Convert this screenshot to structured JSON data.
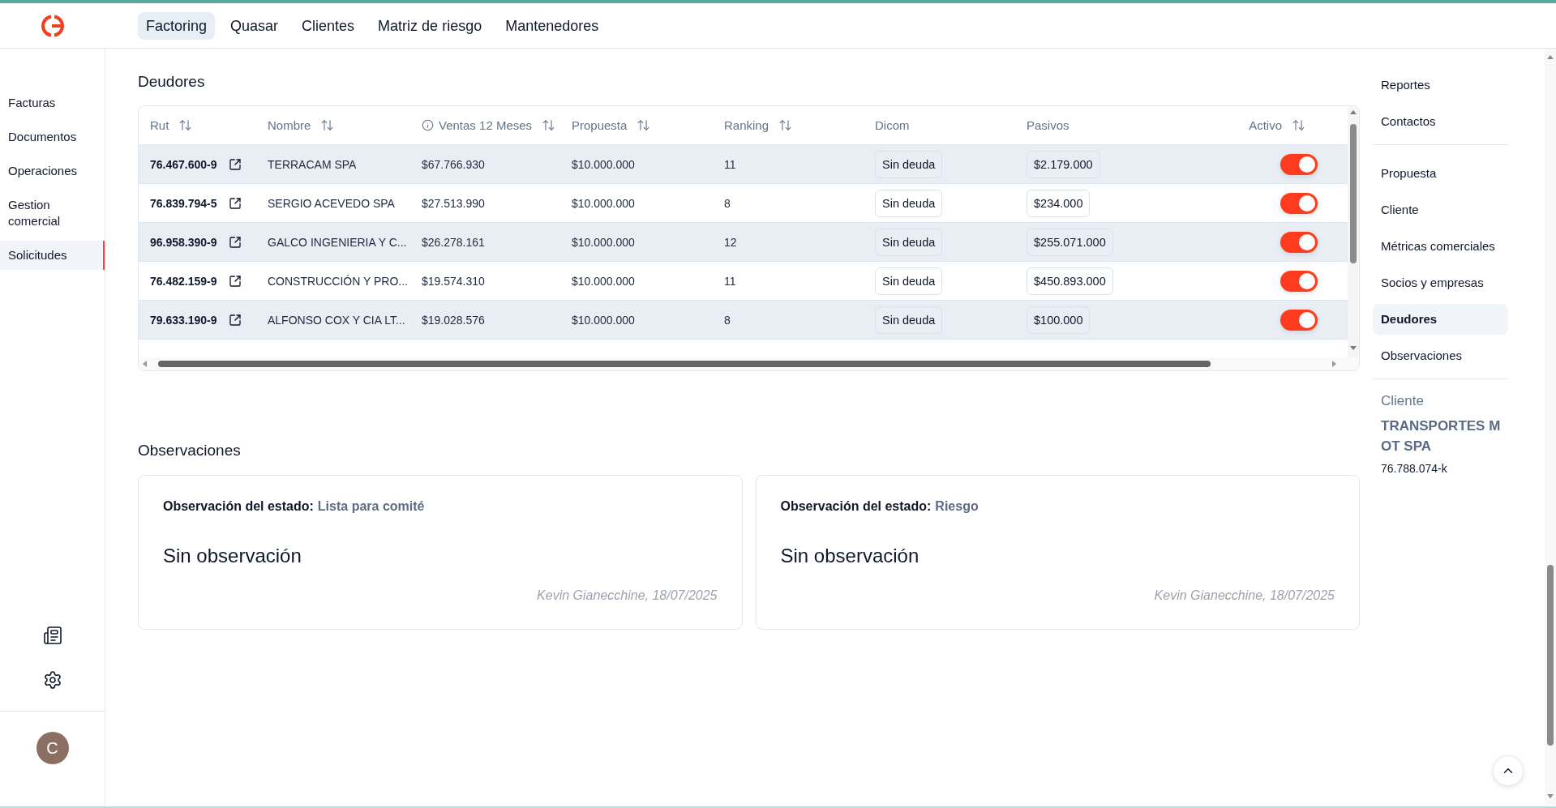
{
  "header": {
    "nav": [
      {
        "label": "Factoring",
        "selected": true
      },
      {
        "label": "Quasar",
        "selected": false
      },
      {
        "label": "Clientes",
        "selected": false
      },
      {
        "label": "Matriz de riesgo",
        "selected": false
      },
      {
        "label": "Mantenedores",
        "selected": false
      }
    ]
  },
  "sidebar": {
    "items": [
      {
        "label": "Facturas",
        "selected": false
      },
      {
        "label": "Documentos",
        "selected": false
      },
      {
        "label": "Operaciones",
        "selected": false
      },
      {
        "label": "Gestion comercial",
        "selected": false
      },
      {
        "label": "Solicitudes",
        "selected": true
      }
    ],
    "user": {
      "initial": "C"
    }
  },
  "deudores": {
    "title": "Deudores",
    "columns": [
      {
        "label": "Rut",
        "kind": "link",
        "sortable": true,
        "info": false
      },
      {
        "label": "Nombre",
        "kind": "text",
        "sortable": true,
        "info": false
      },
      {
        "label": "Ventas 12 Meses",
        "kind": "text",
        "sortable": true,
        "info": true
      },
      {
        "label": "Propuesta",
        "kind": "text",
        "sortable": true,
        "info": false
      },
      {
        "label": "Ranking",
        "kind": "text",
        "sortable": true,
        "info": false
      },
      {
        "label": "Dicom",
        "kind": "badge",
        "sortable": false,
        "info": false
      },
      {
        "label": "Pasivos",
        "kind": "badge",
        "sortable": false,
        "info": false
      },
      {
        "label": "Activo",
        "kind": "toggle",
        "sortable": true,
        "info": false
      }
    ],
    "rows": [
      {
        "cells": [
          "76.467.600-9",
          "TERRACAM SPA",
          "$67.766.930",
          "$10.000.000",
          "11",
          "Sin deuda",
          "$2.179.000"
        ],
        "active": true
      },
      {
        "cells": [
          "76.839.794-5",
          "SERGIO ACEVEDO SPA",
          "$27.513.990",
          "$10.000.000",
          "8",
          "Sin deuda",
          "$234.000"
        ],
        "active": true
      },
      {
        "cells": [
          "96.958.390-9",
          "GALCO INGENIERIA Y C...",
          "$26.278.161",
          "$10.000.000",
          "12",
          "Sin deuda",
          "$255.071.000"
        ],
        "active": true
      },
      {
        "cells": [
          "76.482.159-9",
          "CONSTRUCCIÓN Y PRO...",
          "$19.574.310",
          "$10.000.000",
          "11",
          "Sin deuda",
          "$450.893.000"
        ],
        "active": true
      },
      {
        "cells": [
          "79.633.190-9",
          "ALFONSO COX Y CIA LT...",
          "$19.028.576",
          "$10.000.000",
          "8",
          "Sin deuda",
          "$100.000"
        ],
        "active": true
      }
    ]
  },
  "observaciones": {
    "title": "Observaciones",
    "cards": [
      {
        "label": "Observación del estado:",
        "status": "Lista para comité",
        "text": "Sin observación",
        "author": "Kevin Gianecchine, 18/07/2025"
      },
      {
        "label": "Observación del estado:",
        "status": "Riesgo",
        "text": "Sin observación",
        "author": "Kevin Gianecchine, 18/07/2025"
      }
    ]
  },
  "right_nav": {
    "sections": [
      {
        "items": [
          {
            "label": "Reportes",
            "selected": false
          },
          {
            "label": "Contactos",
            "selected": false
          }
        ]
      },
      {
        "items": [
          {
            "label": "Propuesta",
            "selected": false
          },
          {
            "label": "Cliente",
            "selected": false
          },
          {
            "label": "Métricas comerciales",
            "selected": false
          },
          {
            "label": "Socios y empresas",
            "selected": false
          },
          {
            "label": "Deudores",
            "selected": true
          },
          {
            "label": "Observaciones",
            "selected": false
          }
        ]
      }
    ],
    "client": {
      "label": "Cliente",
      "name": "TRANSPORTES MOT SPA",
      "rut": "76.788.074-k"
    }
  }
}
